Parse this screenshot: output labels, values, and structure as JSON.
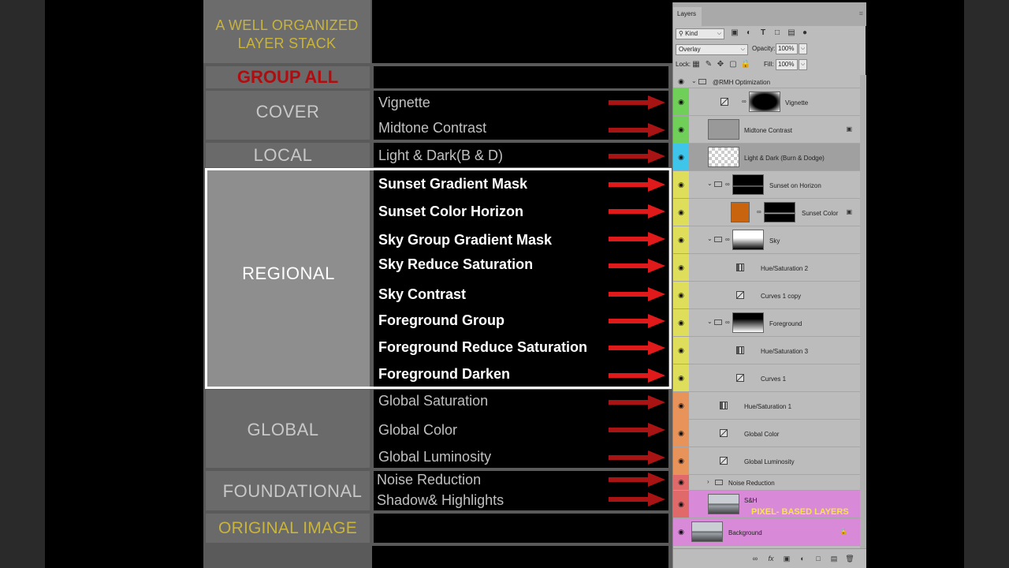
{
  "colors": {
    "arrow": "#e01a1a",
    "gold": "#c9b43c",
    "group_red": "#b00d10",
    "cover_green": "#6fcf58",
    "local_cyan": "#3fc4ea",
    "regional_yellow": "#dede5a",
    "global_orange": "#e8935a",
    "foundational_red": "#e06a6a",
    "pixel_magenta": "#d88ad8"
  },
  "infographic": {
    "title": "A WELL ORGANIZED\nLAYER STACK",
    "sections": {
      "group_all": {
        "label": "GROUP ALL"
      },
      "cover": {
        "label": "COVER",
        "items": [
          "Vignette",
          "Midtone Contrast"
        ]
      },
      "local": {
        "label": "LOCAL",
        "items": [
          "Light & Dark(B & D)"
        ]
      },
      "regional": {
        "label": "REGIONAL",
        "items": [
          "Sunset Gradient Mask",
          "Sunset Color Horizon",
          "Sky Group Gradient Mask",
          "Sky Reduce Saturation",
          "Sky Contrast",
          "Foreground Group",
          "Foreground Reduce Saturation",
          "Foreground Darken"
        ]
      },
      "global": {
        "label": "GLOBAL",
        "items": [
          "Global Saturation",
          "Global Color",
          "Global Luminosity"
        ]
      },
      "foundational": {
        "label": "FOUNDATIONAL",
        "items": [
          "Noise Reduction",
          "Shadow& Highlights"
        ]
      },
      "original": {
        "label": "ORIGINAL IMAGE"
      }
    }
  },
  "layers_panel": {
    "tab": "Layers",
    "filter": {
      "kind": "Kind"
    },
    "blend_mode": "Overlay",
    "opacity_label": "Opacity:",
    "opacity": "100%",
    "lock_label": "Lock:",
    "fill_label": "Fill:",
    "fill": "100%",
    "pixel_note": "PIXEL- BASED LAYERS",
    "layers": [
      {
        "name": "@RMH Optimization",
        "kind": "group",
        "strip": "none"
      },
      {
        "name": "Vignette",
        "kind": "adjust-mask",
        "strip": "cover"
      },
      {
        "name": "Midtone Contrast",
        "kind": "pixel",
        "strip": "cover"
      },
      {
        "name": "Light & Dark (Burn & Dodge)",
        "kind": "transparent",
        "strip": "local"
      },
      {
        "name": "Sunset on Horizon",
        "kind": "group-mask",
        "strip": "regional"
      },
      {
        "name": "Sunset Color",
        "kind": "color-mask",
        "strip": "regional"
      },
      {
        "name": "Sky",
        "kind": "group-mask",
        "strip": "regional"
      },
      {
        "name": "Hue/Saturation 2",
        "kind": "hs",
        "strip": "regional"
      },
      {
        "name": "Curves 1 copy",
        "kind": "curves",
        "strip": "regional"
      },
      {
        "name": "Foreground",
        "kind": "group-mask",
        "strip": "regional"
      },
      {
        "name": "Hue/Saturation 3",
        "kind": "hs",
        "strip": "regional"
      },
      {
        "name": "Curves 1",
        "kind": "curves",
        "strip": "regional"
      },
      {
        "name": "Hue/Saturation 1",
        "kind": "hs",
        "strip": "global"
      },
      {
        "name": "Global Color",
        "kind": "curves",
        "strip": "global"
      },
      {
        "name": "Global Luminosity",
        "kind": "curves",
        "strip": "global"
      },
      {
        "name": "Noise Reduction",
        "kind": "group-closed",
        "strip": "foundational"
      },
      {
        "name": "S&H",
        "kind": "photo",
        "strip": "foundational"
      },
      {
        "name": "Background",
        "kind": "photo-bg",
        "strip": "none"
      }
    ]
  }
}
